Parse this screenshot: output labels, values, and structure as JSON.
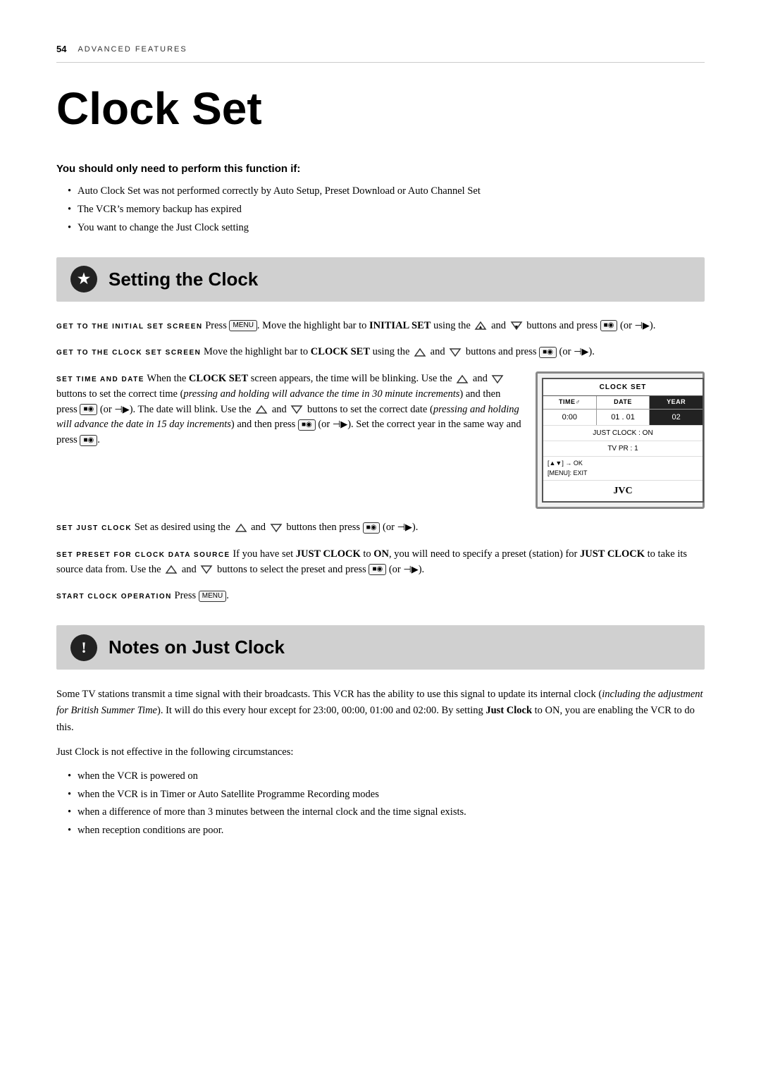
{
  "page": {
    "number": "54",
    "section_label": "ADVANCED FEATURES",
    "title": "Clock Set"
  },
  "warning": {
    "title": "You should only need to perform this function if:",
    "bullets": [
      "Auto Clock Set was not performed correctly by Auto Setup, Preset Download or Auto Channel Set",
      "The VCR’s memory backup has expired",
      "You want to change the Just Clock setting"
    ]
  },
  "section1": {
    "title": "Setting the Clock",
    "icon": "★"
  },
  "steps": {
    "step1_label": "GET TO THE INITIAL SET SCREEN",
    "step1_text": "Press ⓜ. Move the highlight bar to INITIAL SET using the ◁△ and ◁▽ buttons and press ⓜ (or ▹►).",
    "step2_label": "GET TO THE CLOCK SET SCREEN",
    "step2_text": "Move the highlight bar to CLOCK SET using the ◁△ and ◁▽ buttons and press ⓜ (or ▹►).",
    "step3_label": "SET TIME AND DATE",
    "step3_text_1": "When the CLOCK SET screen appears, the time will be blinking. Use the ◁△ and ◁▽ buttons to set the correct time (",
    "step3_italic_1": "pressing and holding will advance the time in 30 minute increments",
    "step3_text_2": ") and then press ⓜ (or ▹►). The date will blink. Use the ◁△ and ◁▽ buttons to set the correct date (",
    "step3_italic_2": "pressing and holding will advance the date in 15 day increments",
    "step3_text_3": ") and then press ⓜ (or ▹►). Set the correct year in the same way and press ⓜ.",
    "step4_label": "SET JUST CLOCK",
    "step4_text": "Set as desired using the ◁△ and ◁▽ buttons then press ⓜ (or ▹►).",
    "step5_label": "SET PRESET FOR CLOCK DATA SOURCE",
    "step5_text": "If you have set JUST CLOCK to ON, you will need to specify a preset (station) for JUST CLOCK to take its source data from. Use the ◁△ and ◁▽ buttons to select the preset and press ⓜ (or ▹►).",
    "step6_label": "START CLOCK OPERATION",
    "step6_text": "Press ⓜ."
  },
  "vcr_screen": {
    "title": "CLOCK SET",
    "col1": "TIME♂",
    "col2": "DATE",
    "col3": "YEAR",
    "time_val": "0:00",
    "date_val": "01 . 01",
    "year_val": "02",
    "just_clock": "JUST CLOCK : ON",
    "tv_pr": "TV PR        :  1",
    "controls": "[▲▼] → OK\n[MENU]: EXIT",
    "brand": "JVC"
  },
  "section2": {
    "title": "Notes on Just Clock",
    "icon": "!"
  },
  "notes": {
    "para1": "Some TV stations transmit a time signal with their broadcasts. This VCR has the ability to use this signal to update its internal clock (",
    "para1_italic": "including the adjustment for British Summer Time",
    "para1_cont": "). It will do this every hour except for 23:00, 00:00, 01:00 and 02:00. By setting ",
    "para1_bold": "Just Clock",
    "para1_end": " to ON, you are enabling the VCR to do this.",
    "para2": "Just Clock is not effective in the following circumstances:",
    "bullets": [
      "when the VCR is powered on",
      "when the VCR is in Timer or Auto Satellite Programme Recording modes",
      "when a difference of more than 3 minutes between the internal clock and the time signal exists.",
      "when reception conditions are poor."
    ]
  }
}
